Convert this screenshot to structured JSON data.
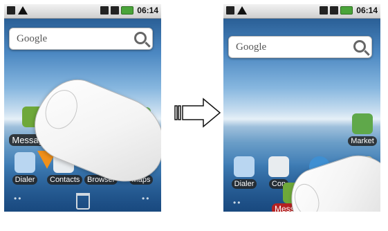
{
  "status": {
    "time": "06:14"
  },
  "search": {
    "label": "Google"
  },
  "left": {
    "drag_label": "Messages",
    "dock": [
      "Dialer",
      "Contacts",
      "Browser",
      "Maps"
    ]
  },
  "right": {
    "market_label": "Market",
    "dock": [
      "Dialer",
      "Con"
    ],
    "drop_label": "Messages"
  },
  "icons": [
    "warning-icon",
    "sim-icon",
    "signal-icon",
    "battery-icon",
    "search-icon",
    "trash-icon",
    "arrow-right-icon"
  ]
}
